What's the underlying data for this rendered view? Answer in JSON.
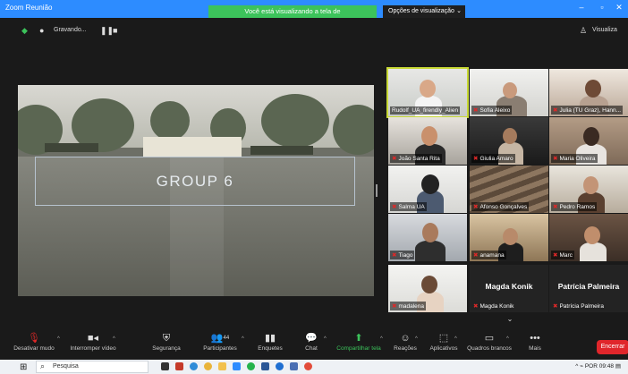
{
  "window": {
    "title": "Zoom Reunião",
    "share_banner": "Você está visualizando a tela de Rudolf_UA_firendly_Alien",
    "view_options": "Opções de visualização"
  },
  "status": {
    "recording": "Gravando...",
    "view": "Visualiza"
  },
  "shared_screen": {
    "title": "GROUP 6"
  },
  "participants": [
    {
      "name": "Rudolf_UA_firendly_Alien",
      "muted": false,
      "active": true
    },
    {
      "name": "Sofia Aleixo",
      "muted": true,
      "active": false
    },
    {
      "name": "Julia (TU Graz), Hann...",
      "muted": true,
      "active": false
    },
    {
      "name": "João Santa Rita",
      "muted": true,
      "active": false
    },
    {
      "name": "Giulia Amaro",
      "muted": true,
      "active": false
    },
    {
      "name": "Maria Oliveira",
      "muted": true,
      "active": false
    },
    {
      "name": "Salma UA",
      "muted": true,
      "active": false
    },
    {
      "name": "Afonso Gonçalves",
      "muted": true,
      "active": false
    },
    {
      "name": "Pedro Ramos",
      "muted": true,
      "active": false
    },
    {
      "name": "Tiago",
      "muted": true,
      "active": false
    },
    {
      "name": "anamana",
      "muted": true,
      "active": false
    },
    {
      "name": "Marc",
      "muted": true,
      "active": false
    },
    {
      "name": "madalena",
      "muted": true,
      "active": false
    },
    {
      "name": "Magda Konik",
      "muted": true,
      "active": false,
      "display_name": "Magda Konik"
    },
    {
      "name": "Patrícia Palmeira",
      "muted": true,
      "active": false,
      "display_name": "Patrícia Palmeira"
    }
  ],
  "toolbar": {
    "mute": "Desativar mudo",
    "video": "Interromper vídeo",
    "security": "Segurança",
    "participants": "Participantes",
    "participants_count": "44",
    "polls": "Enquetes",
    "chat": "Chat",
    "share": "Compartilhar tela",
    "reactions": "Reações",
    "apps": "Aplicativos",
    "whiteboards": "Quadros brancos",
    "more": "Mais",
    "end": "Encerrar"
  },
  "taskbar": {
    "search_placeholder": "Pesquisa",
    "language": "POR",
    "time": "09:48"
  },
  "colors": {
    "zoom_blue": "#2d8cff",
    "share_green": "#3cc35b",
    "end_red": "#e0262b",
    "active_speaker": "#c8d936",
    "muted_red": "#e02828"
  }
}
